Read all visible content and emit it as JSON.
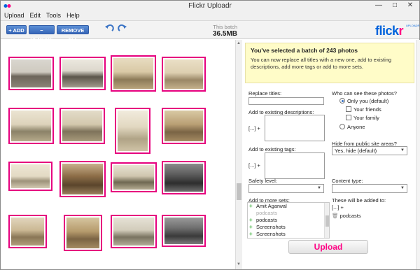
{
  "window": {
    "title": "Flickr Uploadr"
  },
  "menu": [
    "Upload",
    "Edit",
    "Tools",
    "Help"
  ],
  "toolbar": {
    "add": "+ ADD",
    "remove": "− REMOVE",
    "remove_all": "REMOVE ALL",
    "batch_label": "This batch",
    "batch_size": "36.5MB"
  },
  "logo": {
    "word_a": "flick",
    "word_b": "r",
    "tag": "UPLOADR"
  },
  "info": {
    "heading": "You've selected a batch of 243 photos",
    "body": "You can now replace all titles with a new one, add to existing descriptions, add more tags or add to more sets."
  },
  "form": {
    "replace_titles": "Replace titles:",
    "add_descriptions": "Add to existing descriptions:",
    "add_tags": "Add to existing tags:",
    "desc_prefix": "[...] +",
    "tags_prefix": "[...] +",
    "safety_level": "Safety level:",
    "content_type": "Content type:",
    "add_to_sets": "Add to more sets:",
    "will_be_added": "These will be added to:",
    "added_prefix": "[...] +",
    "added_sets": [
      "podcasts"
    ],
    "who_can_see": "Who can see these photos?",
    "privacy": {
      "only_you": "Only you (default)",
      "friends": "Your friends",
      "family": "Your family",
      "anyone": "Anyone"
    },
    "hide_label": "Hide from public site areas?",
    "hide_value": "Yes, hide (default)",
    "safety_value": "",
    "content_value": ""
  },
  "sets": [
    {
      "label": "Amit Agarwal",
      "state": "add"
    },
    {
      "label": "podcasts",
      "state": "used"
    },
    {
      "label": "podcasts",
      "state": "add"
    },
    {
      "label": "Screenshots",
      "state": "add"
    },
    {
      "label": "Screenshots",
      "state": "add"
    }
  ],
  "upload_button": "Upload",
  "colors": {
    "selection": "#e6007e",
    "upload_text": "#ff0084",
    "brand_blue": "#0063dc",
    "info_bg": "#fffcc8"
  }
}
